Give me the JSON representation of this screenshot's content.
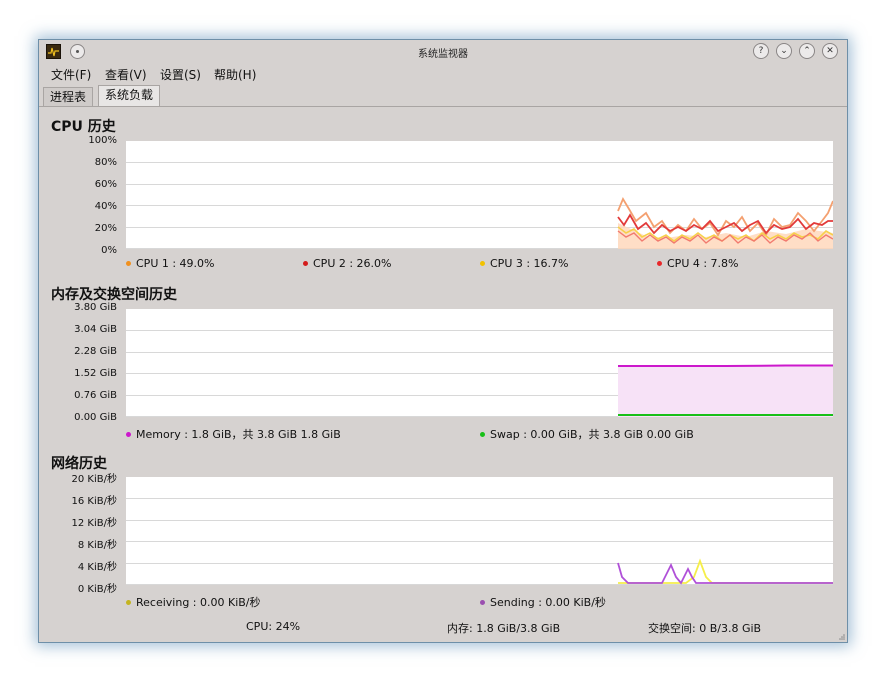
{
  "window": {
    "title": "系统监视器"
  },
  "titlebar_buttons": [
    "?",
    "⌄",
    "⌃",
    "✕"
  ],
  "menu": [
    "文件(F)",
    "查看(V)",
    "设置(S)",
    "帮助(H)"
  ],
  "tabs": [
    {
      "label": "进程表"
    },
    {
      "label": "系统负载",
      "active": true
    }
  ],
  "colors": {
    "cpu1": "#f0901e",
    "cpu2": "#d41c1c",
    "cpu3": "#f2c200",
    "cpu4": "#e8282a",
    "memory": "#cc18cc",
    "swap": "#18c018",
    "receiving": "#c4b420",
    "sending": "#9b4fb0"
  },
  "cpu": {
    "title": "CPU 历史",
    "yticks": [
      "100%",
      "80%",
      "60%",
      "40%",
      "20%",
      "0%"
    ],
    "legend": [
      {
        "text": "CPU 1 : 49.0%",
        "color": "#f0901e"
      },
      {
        "text": "CPU 2 : 26.0%",
        "color": "#d41c1c"
      },
      {
        "text": "CPU 3 : 16.7%",
        "color": "#f2c200"
      },
      {
        "text": "CPU 4 : 7.8%",
        "color": "#e8282a"
      }
    ]
  },
  "memory": {
    "title": "内存及交换空间历史",
    "yticks": [
      "3.80 GiB",
      "3.04 GiB",
      "2.28 GiB",
      "1.52 GiB",
      "0.76 GiB",
      "0.00 GiB"
    ],
    "legend": [
      {
        "text": "Memory : 1.8 GiB，共 3.8 GiB 1.8 GiB",
        "color": "#cc18cc"
      },
      {
        "text": "Swap : 0.00 GiB，共 3.8 GiB 0.00 GiB",
        "color": "#18c018"
      }
    ]
  },
  "network": {
    "title": "网络历史",
    "yticks": [
      "20 KiB/秒",
      "16 KiB/秒",
      "12 KiB/秒",
      "8 KiB/秒",
      "4 KiB/秒",
      "0 KiB/秒"
    ],
    "legend": [
      {
        "text": "Receiving : 0.00 KiB/秒",
        "color": "#c4b420"
      },
      {
        "text": "Sending : 0.00 KiB/秒",
        "color": "#9b4fb0"
      }
    ]
  },
  "status": {
    "cpu": "CPU: 24%",
    "memory": "内存: 1.8 GiB/3.8 GiB",
    "swap": "交换空间:  0 B/3.8 GiB"
  }
}
